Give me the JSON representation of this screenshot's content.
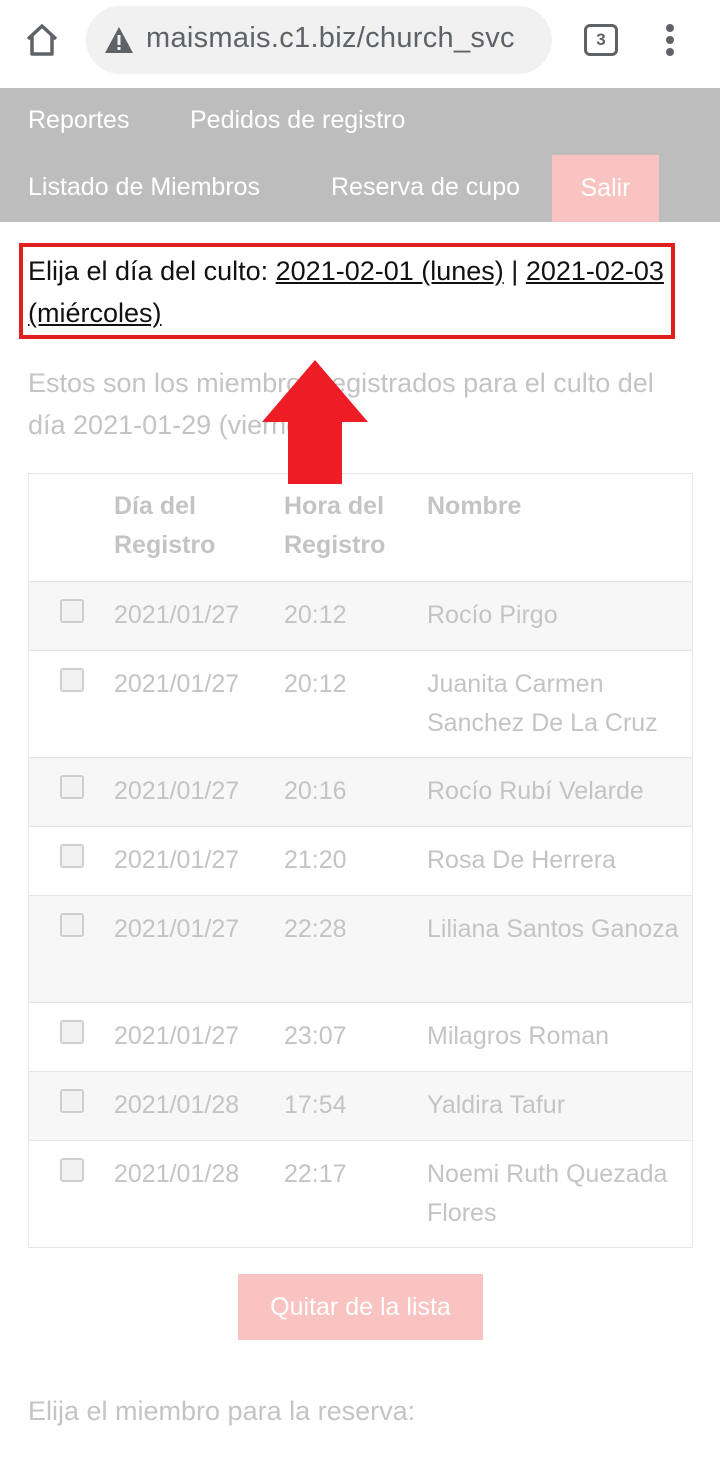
{
  "browser": {
    "url": "maismais.c1.biz/church_svc",
    "tab_count": "3",
    "home_icon": "home-icon",
    "warning_icon": "warning-triangle-icon",
    "menu_icon": "more-vert-icon"
  },
  "nav": {
    "reportes": "Reportes",
    "pedidos": "Pedidos de registro",
    "listado": "Listado de Miembros",
    "reserva": "Reserva de cupo",
    "salir": "Salir"
  },
  "day_chooser": {
    "label": "Elija el día del culto: ",
    "option1": "2021-02-01 (lunes)",
    "separator": " | ",
    "option2": "2021-02-03 (miércoles)"
  },
  "subtitle": "Estos son los miembros registrados para el culto del día 2021-01-29 (viernes)",
  "table": {
    "headers": {
      "date": "Día del Registro",
      "time": "Hora del Registro",
      "name": "Nombre"
    },
    "rows": [
      {
        "date": "2021/01/27",
        "time": "20:12",
        "name": "Rocío Pirgo"
      },
      {
        "date": "2021/01/27",
        "time": "20:12",
        "name": "Juanita Carmen Sanchez De La Cruz"
      },
      {
        "date": "2021/01/27",
        "time": "20:16",
        "name": "Rocío Rubí Velarde"
      },
      {
        "date": "2021/01/27",
        "time": "21:20",
        "name": "Rosa De Herrera"
      },
      {
        "date": "2021/01/27",
        "time": "22:28",
        "name": "Liliana Santos Ganoza"
      },
      {
        "date": "2021/01/27",
        "time": "23:07",
        "name": "Milagros Roman"
      },
      {
        "date": "2021/01/28",
        "time": "17:54",
        "name": "Yaldira Tafur"
      },
      {
        "date": "2021/01/28",
        "time": "22:17",
        "name": "Noemi Ruth Quezada Flores"
      }
    ]
  },
  "quitar_button": "Quitar de la lista",
  "choose_member": "Elija el miembro para la reserva:",
  "colors": {
    "nav_bg": "#bdbdbd",
    "accent_pink": "#f8c3c0",
    "highlight_red": "#e02020",
    "muted_text": "#c4c4c4"
  }
}
